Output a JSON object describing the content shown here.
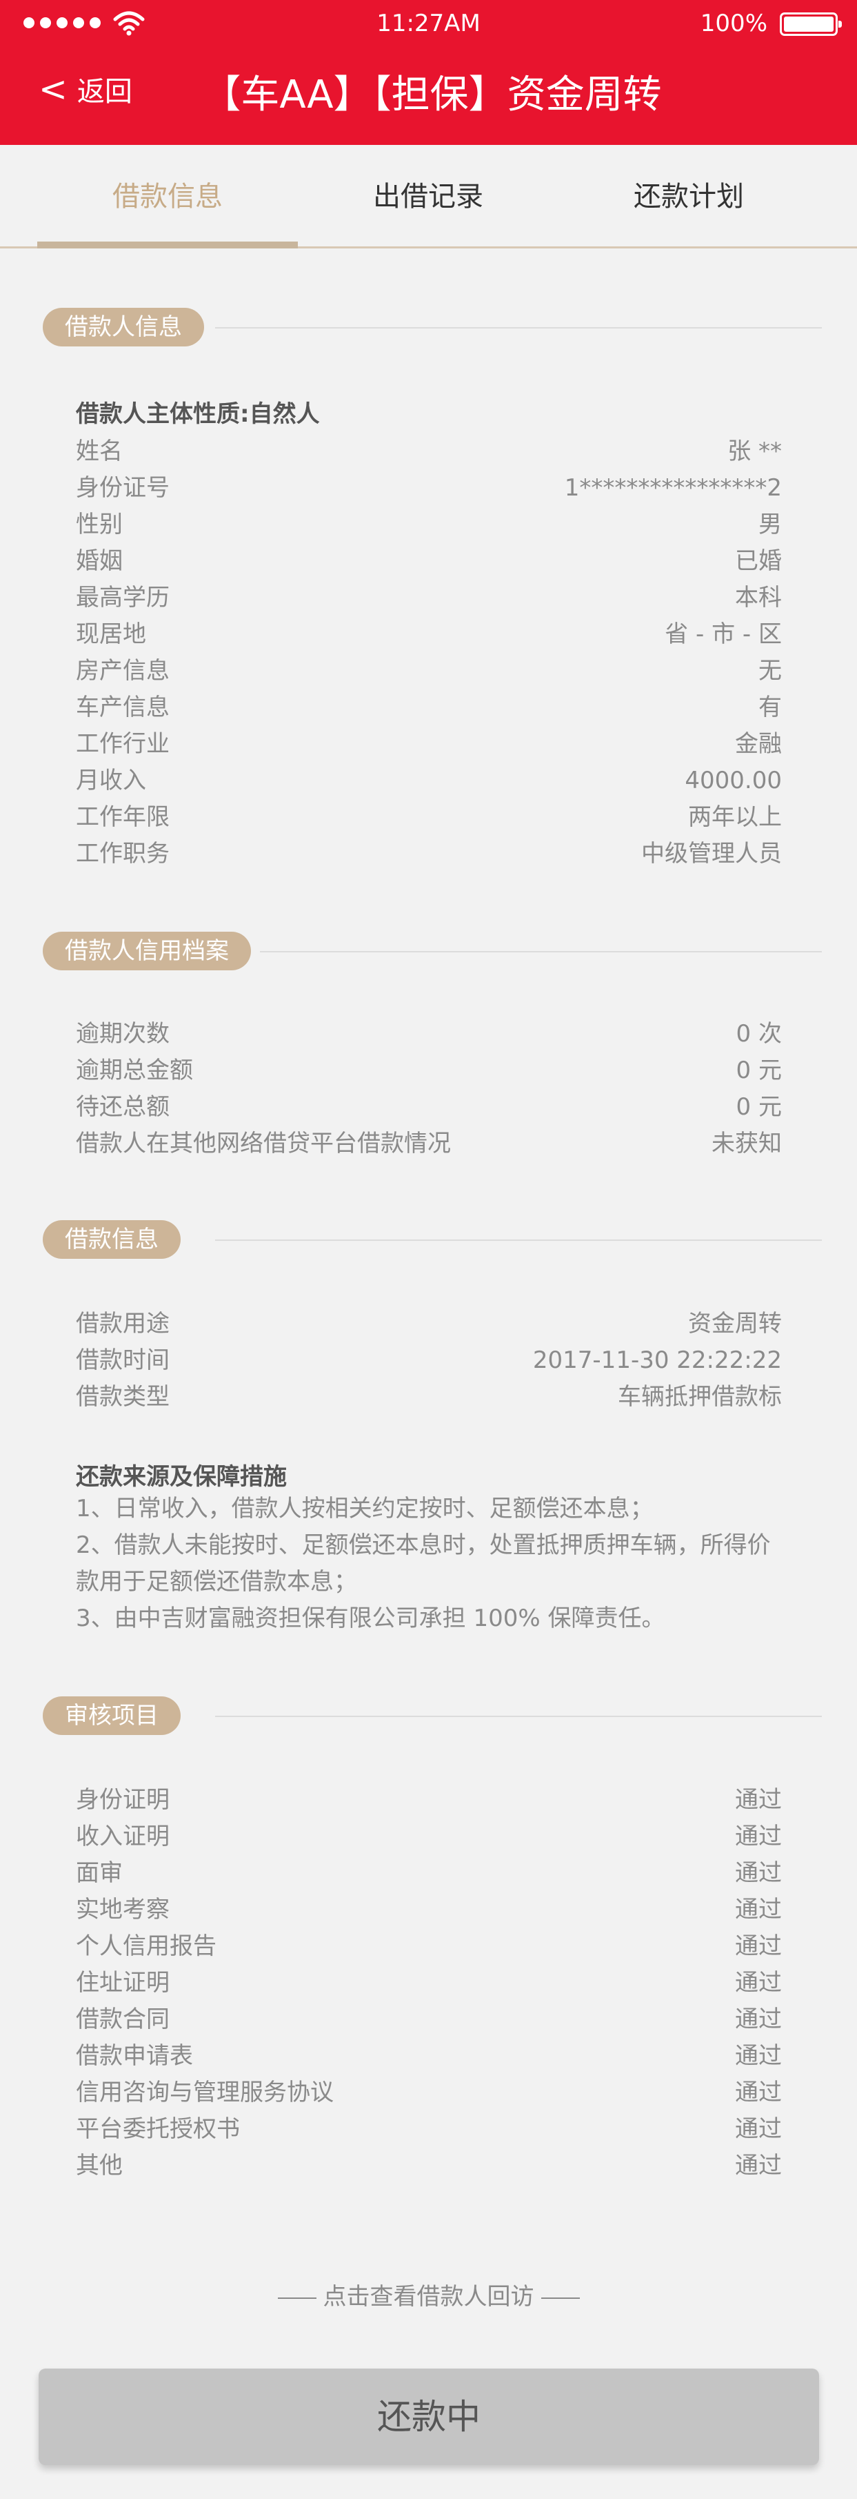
{
  "status_bar": {
    "time": "11:27AM",
    "battery": "100%"
  },
  "header": {
    "back_label": "返回",
    "back_icon": "chevron-left-icon",
    "title": "【车AA】【担保】资金周转"
  },
  "tabs": [
    {
      "label": "借款信息",
      "active": true
    },
    {
      "label": "出借记录",
      "active": false
    },
    {
      "label": "还款计划",
      "active": false
    }
  ],
  "borrower": {
    "section_title": "借款人信息",
    "subject_heading": "借款人主体性质:自然人",
    "rows": [
      {
        "label": "姓名",
        "value": "张 **"
      },
      {
        "label": "身份证号",
        "value": "1****************2"
      },
      {
        "label": "性别",
        "value": "男"
      },
      {
        "label": "婚姻",
        "value": "已婚"
      },
      {
        "label": "最高学历",
        "value": "本科"
      },
      {
        "label": "现居地",
        "value": "省 - 市 - 区"
      },
      {
        "label": "房产信息",
        "value": "无"
      },
      {
        "label": "车产信息",
        "value": "有"
      },
      {
        "label": "工作行业",
        "value": "金融"
      },
      {
        "label": "月收入",
        "value": "4000.00"
      },
      {
        "label": "工作年限",
        "value": "两年以上"
      },
      {
        "label": "工作职务",
        "value": "中级管理人员"
      }
    ]
  },
  "credit": {
    "section_title": "借款人信用档案",
    "rows": [
      {
        "label": "逾期次数",
        "value": "0 次"
      },
      {
        "label": "逾期总金额",
        "value": "0 元"
      },
      {
        "label": "待还总额",
        "value": "0 元"
      },
      {
        "label": "借款人在其他网络借贷平台借款情况",
        "value": "未获知"
      }
    ]
  },
  "loan": {
    "section_title": "借款信息",
    "rows": [
      {
        "label": "借款用途",
        "value": "资金周转"
      },
      {
        "label": "借款时间",
        "value": "2017-11-30 22:22:22"
      },
      {
        "label": "借款类型",
        "value": "车辆抵押借款标"
      }
    ],
    "repay_heading": "还款来源及保障措施",
    "repay_items": [
      "1、日常收入，借款人按相关约定按时、足额偿还本息；",
      "2、借款人未能按时、足额偿还本息时，处置抵押质押车辆，所得价款用于足额偿还借款本息；",
      "3、由中吉财富融资担保有限公司承担 100% 保障责任。"
    ]
  },
  "audit": {
    "section_title": "审核项目",
    "rows": [
      {
        "label": "身份证明",
        "value": "通过"
      },
      {
        "label": "收入证明",
        "value": "通过"
      },
      {
        "label": "面审",
        "value": "通过"
      },
      {
        "label": "实地考察",
        "value": "通过"
      },
      {
        "label": "个人信用报告",
        "value": "通过"
      },
      {
        "label": "住址证明",
        "value": "通过"
      },
      {
        "label": "借款合同",
        "value": "通过"
      },
      {
        "label": "借款申请表",
        "value": "通过"
      },
      {
        "label": "信用咨询与管理服务协议",
        "value": "通过"
      },
      {
        "label": "平台委托授权书",
        "value": "通过"
      },
      {
        "label": "其他",
        "value": "通过"
      }
    ]
  },
  "visit_link": "点击查看借款人回访",
  "bottom_button": "还款中",
  "colors": {
    "header_red": "#e8142e",
    "accent_tan": "#cdb598",
    "tab_active": "#c7ab87"
  }
}
